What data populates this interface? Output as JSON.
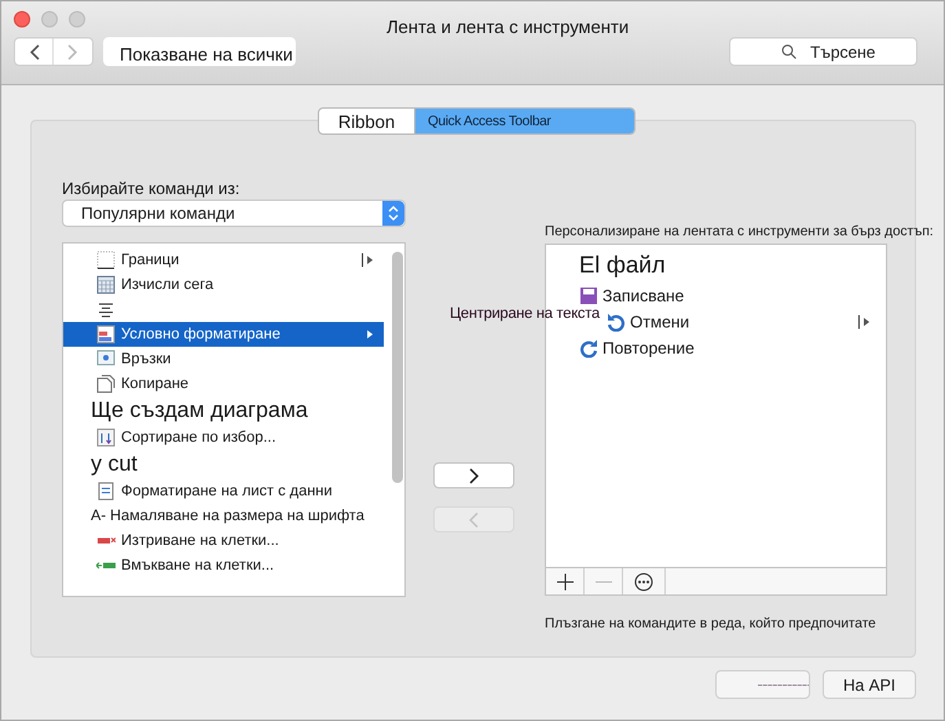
{
  "window": {
    "title": "Лента и лента с инструменти"
  },
  "toolbar": {
    "show_all": "Показване на всички",
    "search_placeholder": "Търсене"
  },
  "tabs": [
    {
      "label": "Ribbon",
      "selected": false
    },
    {
      "label": "Quick Access Toolbar",
      "selected": true
    }
  ],
  "commands": {
    "label": "Избирайте команди из:",
    "dropdown": "Популярни команди",
    "items": [
      {
        "kind": "borders",
        "label": "Граници",
        "submenu": true,
        "selected": false
      },
      {
        "kind": "calculator",
        "label": "Изчисли сега",
        "submenu": false,
        "selected": false
      },
      {
        "kind": "align",
        "submenu": false,
        "selected": false
      },
      {
        "kind": "conditional",
        "label": "Условно форматиране",
        "submenu": true,
        "selected": true
      },
      {
        "kind": "links",
        "label": "Връзки",
        "submenu": false,
        "selected": false
      },
      {
        "kind": "copy",
        "label": "Копиране",
        "submenu": false,
        "selected": false
      },
      {
        "kind": "large",
        "label": "Ще създам диаграма",
        "submenu": false,
        "selected": false
      },
      {
        "kind": "sort",
        "label": "Сортиране по избор...",
        "submenu": false,
        "selected": false
      },
      {
        "kind": "large",
        "label": "у cut",
        "submenu": false,
        "selected": false
      },
      {
        "kind": "format",
        "label": "Форматиране на лист с данни",
        "submenu": false,
        "selected": false
      },
      {
        "kind": "plain",
        "label": "А- Намаляване на размера на шрифта",
        "submenu": false,
        "selected": false
      },
      {
        "kind": "delete",
        "label": "Изтриване на клетки...",
        "submenu": false,
        "selected": false
      },
      {
        "kind": "insert",
        "label": "Вмъкване на клетки...",
        "submenu": false,
        "selected": false
      }
    ]
  },
  "move_buttons": [
    {
      "kind": "add",
      "disabled": false
    },
    {
      "kind": "remove",
      "disabled": true
    }
  ],
  "toolbar_list": {
    "label": "Персонализиране на лентата с инструменти за бърз достъп:",
    "overlay_label": "Центриране на текста",
    "items": [
      {
        "kind": "large",
        "label": "El файл",
        "submenu": false
      },
      {
        "kind": "save",
        "label": "Записване",
        "submenu": false
      },
      {
        "kind": "undo",
        "label": "Отмени",
        "submenu": true
      },
      {
        "kind": "redo",
        "label": "Повторение",
        "submenu": false
      }
    ],
    "hint": "Плъзгане на командите в реда, който предпочитате"
  },
  "footer": {
    "ok": "На API"
  }
}
